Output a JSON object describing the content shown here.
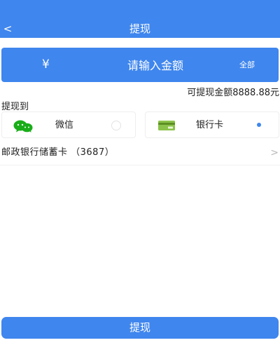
{
  "header": {
    "back_label": "<",
    "title": "提现"
  },
  "amount": {
    "currency_symbol": "¥",
    "value": "",
    "placeholder": "请输入金额",
    "all_label": "全部"
  },
  "available_balance": "可提现金额8888.88元",
  "withdraw_to_label": "提现到",
  "methods": [
    {
      "label": "微信",
      "icon": "wechat-icon",
      "selected": false
    },
    {
      "label": "银行卡",
      "icon": "bank-card-icon",
      "selected": true
    }
  ],
  "selected_card": {
    "name": "邮政银行储蓄卡 （3687）",
    "chevron": ">"
  },
  "submit_label": "提现",
  "colors": {
    "accent": "#3f86ee",
    "wechat_green": "#1aad19",
    "bank_icon_green": "#8bc34a"
  }
}
